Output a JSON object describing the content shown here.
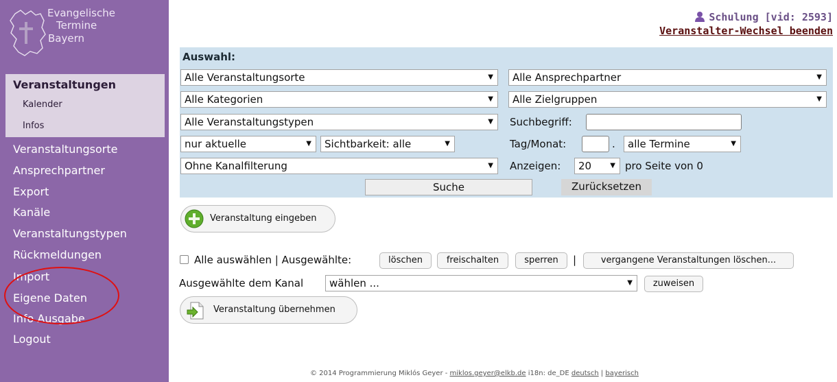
{
  "sidebar": {
    "logo_lines": [
      "Evangelische",
      "Termine",
      "Bayern"
    ],
    "section_title": "Veranstaltungen",
    "sub_items": [
      "Kalender",
      "Infos"
    ],
    "items": [
      "Veranstaltungsorte",
      "Ansprechpartner",
      "Export",
      "Kanäle",
      "Veranstaltungstypen",
      "Rückmeldungen",
      "Import",
      "Eigene Daten",
      "Info Ausgabe",
      "Logout"
    ],
    "background": "#8c67a8",
    "active_background": "#ddd3e2"
  },
  "header": {
    "user_label": "Schulung [vid: 2593]",
    "switch_link": "Veranstalter-Wechsel beenden"
  },
  "filter": {
    "title": "Auswahl:",
    "location": "Alle Veranstaltungsorte",
    "contact": "Alle Ansprechpartner",
    "category": "Alle Kategorien",
    "target_group": "Alle Zielgruppen",
    "type": "Alle Veranstaltungstypen",
    "search_label": "Suchbegriff:",
    "search_value": "",
    "current": "nur aktuelle",
    "visibility": "Sichtbarkeit: alle",
    "day_month_label": "Tag/Monat:",
    "day_month_value": "",
    "day_month_sep": ".",
    "dates": "alle Termine",
    "channel": "Ohne Kanalfilterung",
    "show_label": "Anzeigen:",
    "per_page": "20",
    "per_page_suffix": "pro Seite von 0",
    "search_button": "Suche",
    "reset_button": "Zurücksetzen",
    "panel_color": "#cfe1ee"
  },
  "actions": {
    "add_event": "Veranstaltung eingeben",
    "select_all": "Alle auswählen | Ausgewählte:",
    "delete": "löschen",
    "unlock": "freischalten",
    "lock": "sperren",
    "separator": "|",
    "delete_past": "vergangene Veranstaltungen löschen...",
    "assign_label": "Ausgewählte dem Kanal",
    "channel_select": "wählen ...",
    "assign_button": "zuweisen",
    "take_over": "Veranstaltung übernehmen"
  },
  "footer": {
    "copyright": "© 2014 Programmierung Miklós Geyer -",
    "email": "miklos.geyer@elkb.de",
    "i18n": "i18n: de_DE",
    "lang_de": "deutsch",
    "lang_sep": "|",
    "lang_bay": "bayerisch"
  }
}
